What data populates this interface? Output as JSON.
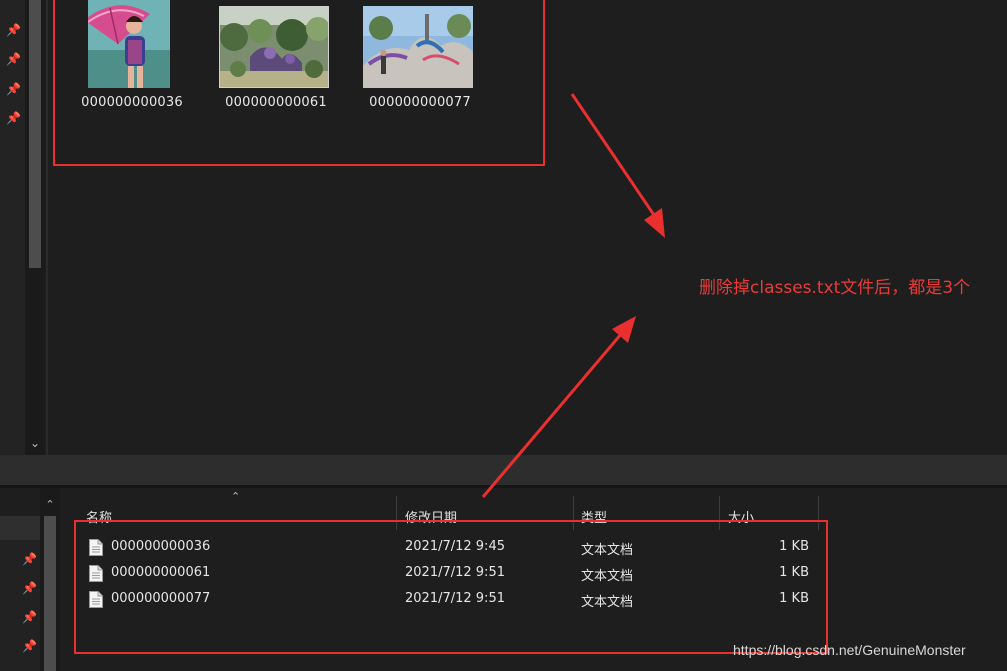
{
  "top_window": {
    "thumbnails": [
      {
        "name": "000000000036",
        "icon": "photo-woman-pink-umbrella"
      },
      {
        "name": "000000000061",
        "icon": "photo-garden-plants"
      },
      {
        "name": "000000000077",
        "icon": "photo-skatepark"
      }
    ],
    "pin_icons": 4
  },
  "annotation": {
    "text": "删除掉classes.txt文件后，都是3个",
    "color": "#ea3b3b"
  },
  "bottom_window": {
    "columns": {
      "name": "名称",
      "date": "修改日期",
      "type": "类型",
      "size": "大小"
    },
    "files": [
      {
        "name": "000000000036",
        "date": "2021/7/12 9:45",
        "type": "文本文档",
        "size": "1 KB"
      },
      {
        "name": "000000000061",
        "date": "2021/7/12 9:51",
        "type": "文本文档",
        "size": "1 KB"
      },
      {
        "name": "000000000077",
        "date": "2021/7/12 9:51",
        "type": "文本文档",
        "size": "1 KB"
      }
    ]
  },
  "watermark": "https://blog.csdn.net/GenuineMonster",
  "colors": {
    "background": "#1e1e1e",
    "highlight_border": "#ea2f2f",
    "annotation": "#ea3b3b"
  }
}
